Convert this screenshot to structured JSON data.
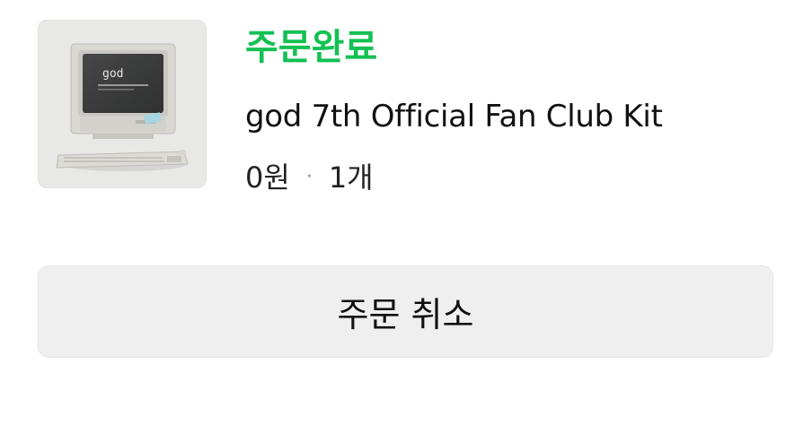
{
  "order": {
    "status": "주문완료",
    "status_color": "#14c053",
    "product_name": "god 7th Official Fan Club Kit",
    "price": "0원",
    "separator": "·",
    "quantity": "1개",
    "thumbnail": {
      "icon": "retro-computer-image",
      "screen_text": "god"
    }
  },
  "actions": {
    "cancel_label": "주문 취소"
  }
}
